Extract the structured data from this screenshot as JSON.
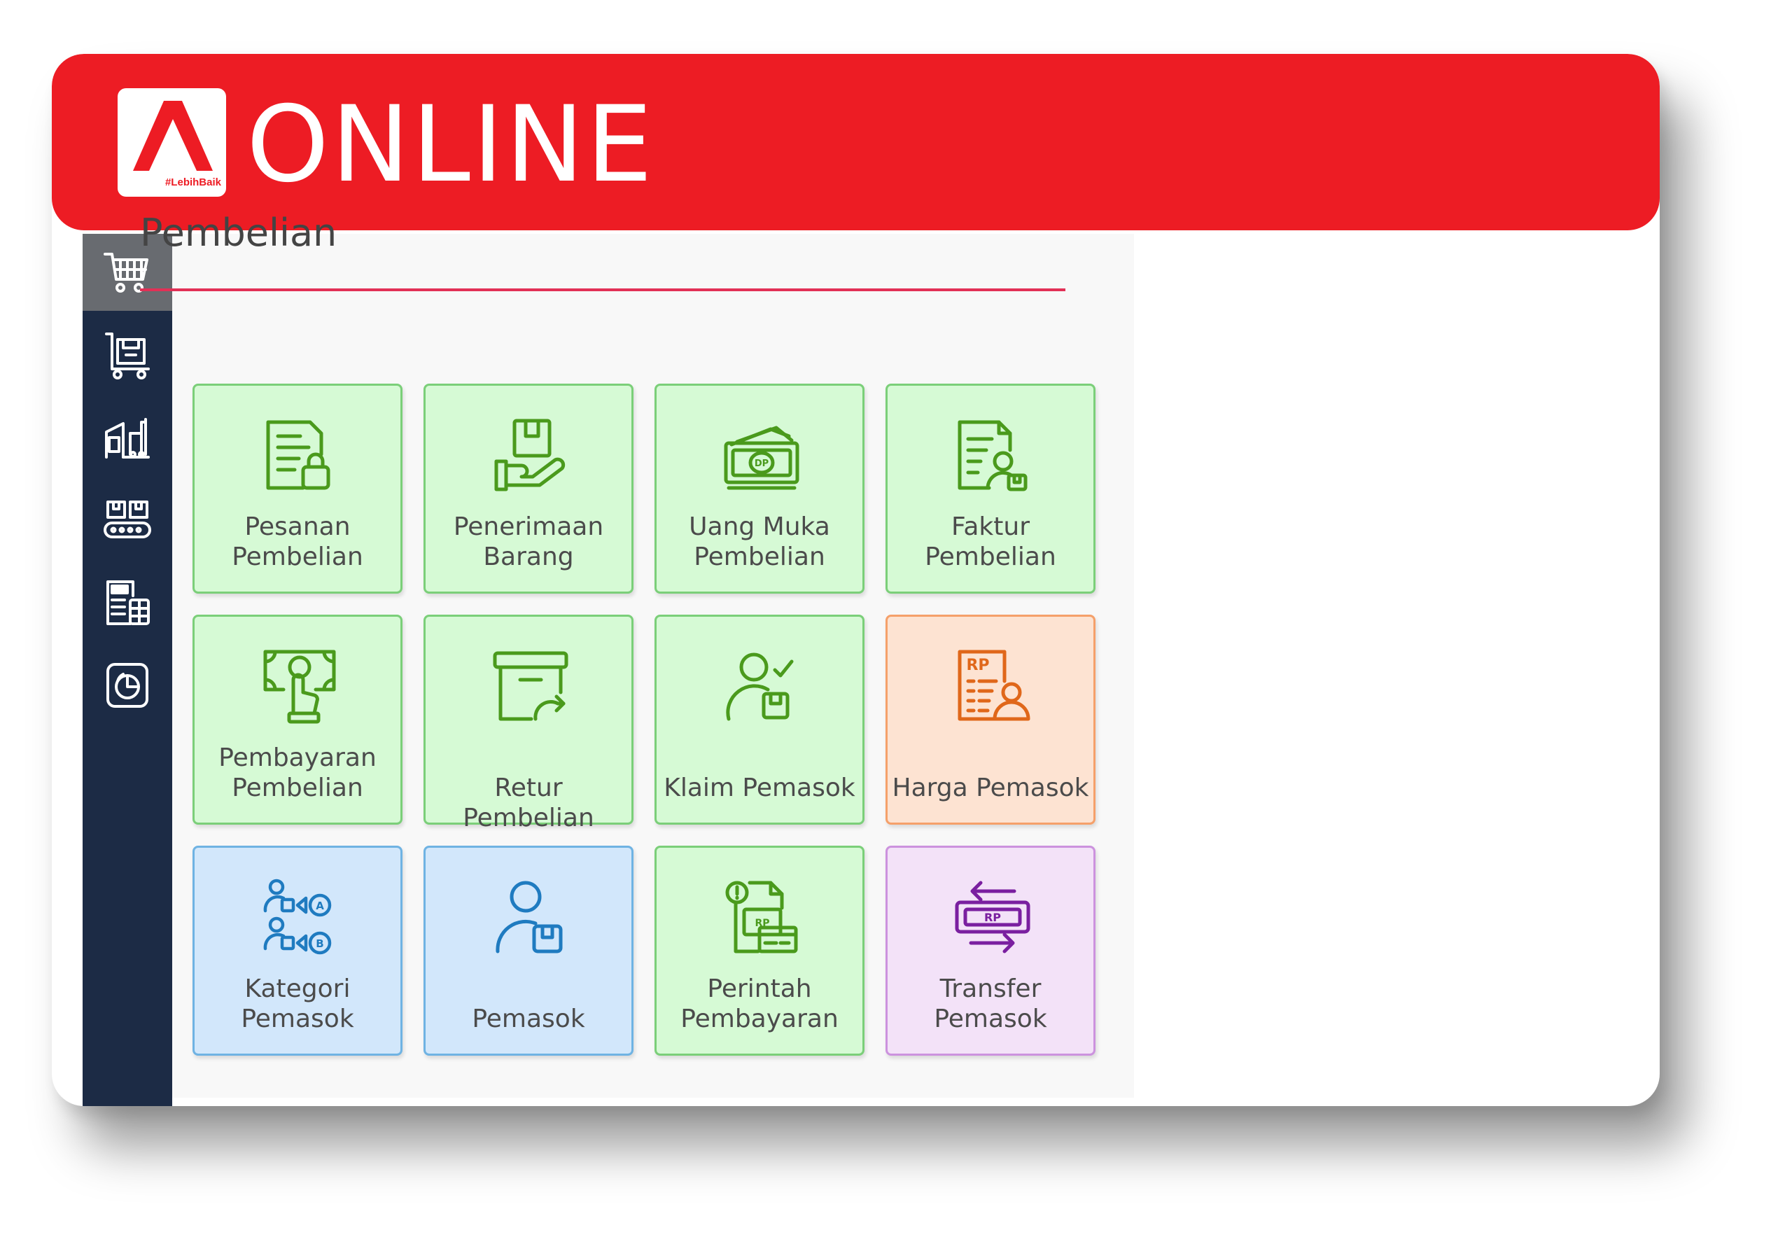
{
  "header": {
    "logo_tag": "#LebihBaik",
    "brand": "ONLINE",
    "brand_color": "#ed1c24"
  },
  "sidebar": {
    "items": [
      {
        "icon": "cart-icon",
        "active": true
      },
      {
        "icon": "box-trolley-icon",
        "active": false
      },
      {
        "icon": "warehouse-icon",
        "active": false
      },
      {
        "icon": "conveyor-icon",
        "active": false
      },
      {
        "icon": "tax-document-icon",
        "active": false
      },
      {
        "icon": "report-chart-icon",
        "active": false
      }
    ]
  },
  "main": {
    "title": "Pembelian",
    "tiles": [
      {
        "label": "Pesanan\nPembelian",
        "icon": "purchase-order-icon",
        "color": "green"
      },
      {
        "label": "Penerimaan\nBarang",
        "icon": "receive-goods-icon",
        "color": "green"
      },
      {
        "label": "Uang Muka\nPembelian",
        "icon": "down-payment-icon",
        "color": "green"
      },
      {
        "label": "Faktur\nPembelian",
        "icon": "purchase-invoice-icon",
        "color": "green"
      },
      {
        "label": "Pembayaran\nPembelian",
        "icon": "purchase-payment-icon",
        "color": "green"
      },
      {
        "label": "Retur Pembelian",
        "icon": "purchase-return-icon",
        "color": "green"
      },
      {
        "label": "Klaim Pemasok",
        "icon": "vendor-claim-icon",
        "color": "green"
      },
      {
        "label": "Harga Pemasok",
        "icon": "vendor-price-icon",
        "color": "orange"
      },
      {
        "label": "Kategori\nPemasok",
        "icon": "vendor-category-icon",
        "color": "blue"
      },
      {
        "label": "Pemasok",
        "icon": "vendor-icon",
        "color": "blue"
      },
      {
        "label": "Perintah\nPembayaran",
        "icon": "payment-order-icon",
        "color": "green"
      },
      {
        "label": "Transfer\nPemasok",
        "icon": "vendor-transfer-icon",
        "color": "purple"
      }
    ]
  },
  "colors": {
    "green_icon": "#4a9a1c",
    "orange_icon": "#e0671a",
    "blue_icon": "#1f7bc0",
    "purple_icon": "#7a1fa0",
    "sidebar_bg": "#1c2b45",
    "divider": "#e23056"
  }
}
